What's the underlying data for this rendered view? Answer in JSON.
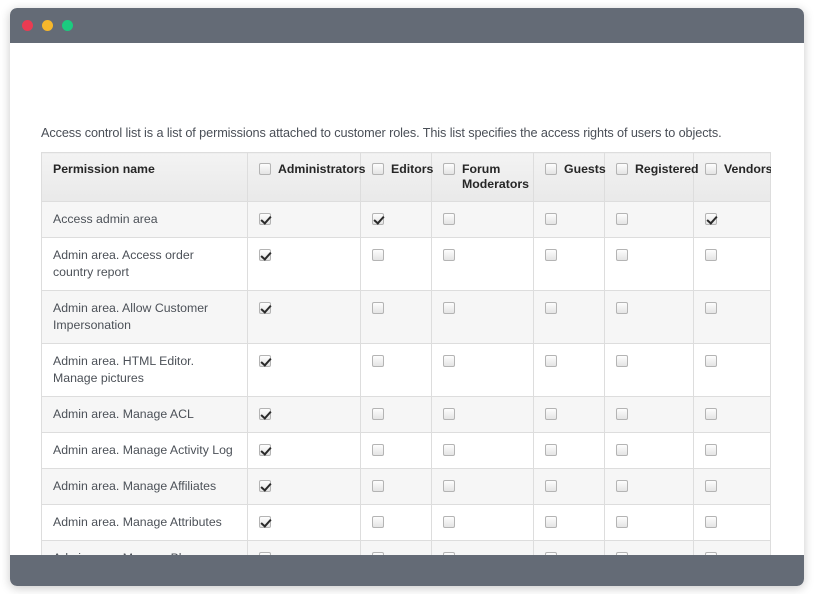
{
  "window": {
    "traffic_lights": [
      {
        "name": "close",
        "color": "#ea3b52"
      },
      {
        "name": "minimize",
        "color": "#f7b72b"
      },
      {
        "name": "maximize",
        "color": "#1bcb7f"
      }
    ],
    "chrome_color": "#646b76"
  },
  "page": {
    "intro": "Access control list is a list of permissions attached to customer roles. This list specifies the access rights of users to objects."
  },
  "table": {
    "name_column_header": "Permission name",
    "role_columns": [
      {
        "label": "Administrators",
        "checked": false
      },
      {
        "label": "Editors",
        "checked": false
      },
      {
        "label": "Forum Moderators",
        "checked": false
      },
      {
        "label": "Guests",
        "checked": false
      },
      {
        "label": "Registered",
        "checked": false
      },
      {
        "label": "Vendors",
        "checked": false
      }
    ],
    "rows": [
      {
        "name": "Access admin area",
        "values": [
          true,
          true,
          false,
          false,
          false,
          true
        ]
      },
      {
        "name": "Admin area. Access order country report",
        "values": [
          true,
          false,
          false,
          false,
          false,
          false
        ]
      },
      {
        "name": "Admin area. Allow Customer Impersonation",
        "values": [
          true,
          false,
          false,
          false,
          false,
          false
        ]
      },
      {
        "name": "Admin area. HTML Editor. Manage pictures",
        "values": [
          true,
          false,
          false,
          false,
          false,
          false
        ]
      },
      {
        "name": "Admin area. Manage ACL",
        "values": [
          true,
          false,
          false,
          false,
          false,
          false
        ]
      },
      {
        "name": "Admin area. Manage Activity Log",
        "values": [
          true,
          false,
          false,
          false,
          false,
          false
        ]
      },
      {
        "name": "Admin area. Manage Affiliates",
        "values": [
          true,
          false,
          false,
          false,
          false,
          false
        ]
      },
      {
        "name": "Admin area. Manage Attributes",
        "values": [
          true,
          false,
          false,
          false,
          false,
          false
        ]
      },
      {
        "name": "Admin area. Manage Blog",
        "values": [
          true,
          true,
          false,
          false,
          false,
          false
        ]
      }
    ]
  }
}
